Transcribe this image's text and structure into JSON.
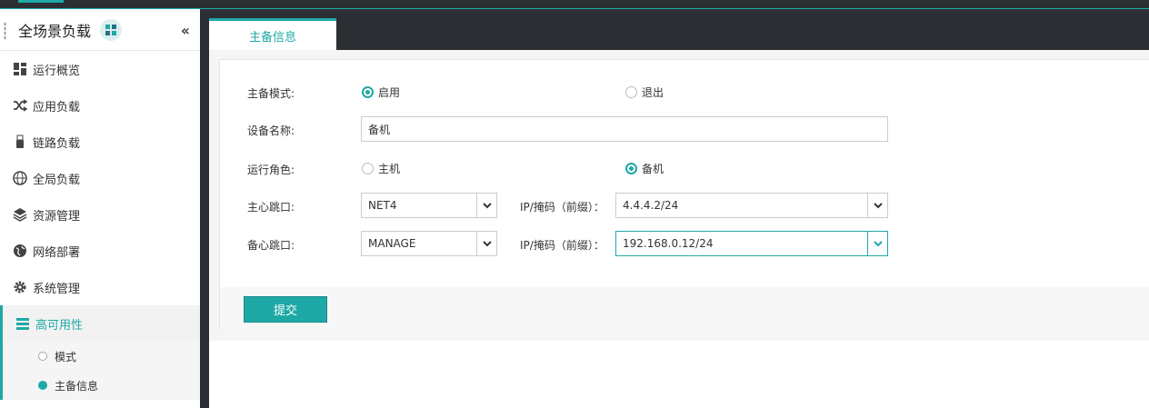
{
  "app": {
    "title": "全场景负载"
  },
  "sidebar": {
    "items": [
      {
        "label": "运行概览",
        "icon": "dashboard-icon"
      },
      {
        "label": "应用负载",
        "icon": "shuffle-icon"
      },
      {
        "label": "链路负载",
        "icon": "usb-icon"
      },
      {
        "label": "全局负载",
        "icon": "globe-icon"
      },
      {
        "label": "资源管理",
        "icon": "layers-icon"
      },
      {
        "label": "网络部署",
        "icon": "earth-icon"
      },
      {
        "label": "系统管理",
        "icon": "gear-icon"
      },
      {
        "label": "高可用性",
        "icon": "list-icon",
        "active": true
      }
    ],
    "subitems": [
      {
        "label": "模式",
        "selected": false
      },
      {
        "label": "主备信息",
        "selected": true
      }
    ]
  },
  "tab": {
    "label": "主备信息"
  },
  "form": {
    "mode": {
      "label": "主备模式:",
      "options": [
        "启用",
        "退出"
      ],
      "selected": "启用"
    },
    "device_name": {
      "label": "设备名称:",
      "value": "备机"
    },
    "role": {
      "label": "运行角色:",
      "options": [
        "主机",
        "备机"
      ],
      "selected": "备机"
    },
    "primary_heartbeat": {
      "label": "主心跳口:",
      "port": "NET4",
      "ip_label": "IP/掩码（前缀）：",
      "ip": "4.4.4.2/24"
    },
    "backup_heartbeat": {
      "label": "备心跳口:",
      "port": "MANAGE",
      "ip_label": "IP/掩码（前缀）：",
      "ip": "192.168.0.12/24"
    },
    "submit_label": "提交"
  },
  "colors": {
    "accent": "#1fa9a6",
    "dark": "#2b2f33"
  }
}
